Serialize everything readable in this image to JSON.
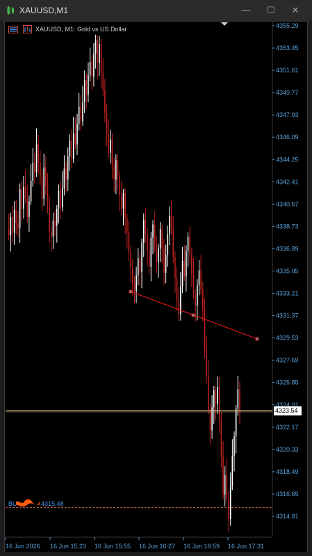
{
  "window": {
    "title": "XAUUSD,M1",
    "minimize": "—",
    "maximize": "☐",
    "close": "✕"
  },
  "chart_header": {
    "label": "XAUUSD, M1:  Gold vs US Dollar"
  },
  "current_price_tag": "4323.54",
  "buy_label": "BU",
  "buy_price": "4315.48",
  "colors": {
    "background": "#000000",
    "axis_text": "#5aa0d8",
    "bull": "#ffffff",
    "bear": "#c0211e",
    "trendline": "#e01818",
    "bid_line": "#f5c994",
    "buy_line": "#d86b4c",
    "redaction": "#ff5a10"
  },
  "chart_data": {
    "type": "candlestick",
    "title": "XAUUSD, M1:  Gold vs US Dollar",
    "y_ticks": [
      "4355.29",
      "4353.45",
      "4351.61",
      "4349.77",
      "4347.93",
      "4346.09",
      "4344.25",
      "4342.41",
      "4340.57",
      "4338.73",
      "4336.89",
      "4335.05",
      "4333.21",
      "4331.37",
      "4329.53",
      "4327.69",
      "4325.85",
      "4324.01",
      "4322.17",
      "4320.33",
      "4318.49",
      "4316.65",
      "4314.81"
    ],
    "x_ticks": [
      "16 Jun 2026",
      "16 Jun 15:23",
      "16 Jun 15:55",
      "16 Jun 16:27",
      "16 Jun 16:59",
      "16 Jun 17:31"
    ],
    "ylim": [
      4313.5,
      4356.5
    ],
    "current_price": 4323.54,
    "buy_order_price": 4315.48,
    "trendline_points": [
      [
        4333.2,
        0
      ],
      [
        4331.3,
        1
      ],
      [
        4329.5,
        2
      ]
    ],
    "price_path": [
      4338.5,
      4338.0,
      4339.5,
      4338.2,
      4340.1,
      4339.0,
      4338.6,
      4341.8,
      4340.2,
      4342.0,
      4341.0,
      4339.5,
      4340.8,
      4342.5,
      4344.0,
      4343.2,
      4345.5,
      4344.0,
      4342.8,
      4341.0,
      4343.6,
      4342.1,
      4340.5,
      4338.3,
      4337.9,
      4339.2,
      4338.8,
      4340.2,
      4341.7,
      4340.3,
      4341.9,
      4343.5,
      4342.6,
      4344.5,
      4345.8,
      4344.3,
      4346.4,
      4345.5,
      4347.2,
      4348.6,
      4347.4,
      4349.0,
      4350.8,
      4349.6,
      4351.2,
      4352.3,
      4351.1,
      4353.0,
      4354.1,
      4352.2,
      4353.8,
      4351.4,
      4350.0,
      4348.1,
      4346.3,
      4344.8,
      4345.9,
      4343.8,
      4342.6,
      4344.2,
      4342.9,
      4341.3,
      4340.2,
      4341.5,
      4339.4,
      4338.2,
      4336.6,
      4335.3,
      4334.0,
      4333.4,
      4334.7,
      4336.1,
      4335.0,
      4337.4,
      4339.3,
      4338.1,
      4336.7,
      4335.4,
      4337.8,
      4338.9,
      4337.2,
      4335.8,
      4336.9,
      4338.5,
      4337.0,
      4334.9,
      4336.4,
      4338.1,
      4339.6,
      4338.4,
      4336.2,
      4334.5,
      4332.6,
      4331.5,
      4333.8,
      4335.9,
      4334.6,
      4336.7,
      4337.9,
      4336.4,
      4334.8,
      4333.1,
      4332.2,
      4333.9,
      4335.1,
      4333.5,
      4331.9,
      4328.6,
      4326.4,
      4323.6,
      4321.9,
      4323.8,
      4325.2,
      4324.1,
      4325.5,
      4322.6,
      4319.7,
      4316.6,
      4318.2,
      4316.3,
      4314.6,
      4317.3,
      4319.8,
      4321.4,
      4323.7,
      4325.3,
      4323.5
    ]
  }
}
